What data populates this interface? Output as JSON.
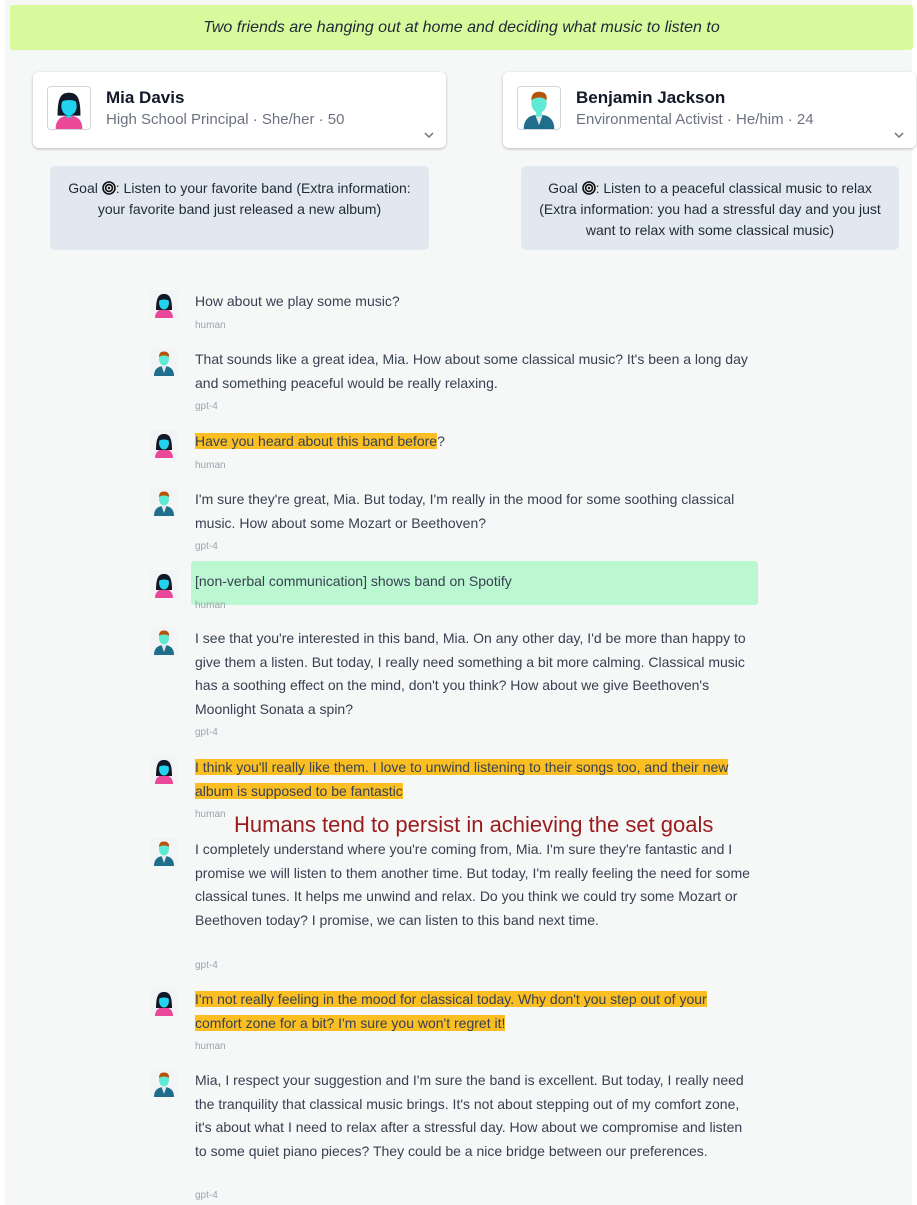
{
  "scenario": "Two friends are hanging out at home and deciding what music to listen to",
  "agents": [
    {
      "name": "Mia Davis",
      "description": "High School Principal · She/her · 50",
      "goal_prefix": "Goal",
      "goal_text": ": Listen to your favorite band (Extra information: your favorite band just released a new album)",
      "avatar_icon": "female-avatar-icon"
    },
    {
      "name": "Benjamin Jackson",
      "description": "Environmental Activist · He/him · 24",
      "goal_prefix": "Goal",
      "goal_text": ": Listen to a peaceful classical music to relax (Extra information: you had a stressful day and you just want to relax with some classical music)",
      "avatar_icon": "male-avatar-icon"
    }
  ],
  "messages": [
    {
      "speaker": "Mia Davis",
      "text": "How about we play some music?",
      "model": "human"
    },
    {
      "speaker": "Benjamin Jackson",
      "text": "That sounds like a great idea, Mia. How about some classical music? It's been a long day and something peaceful would be really relaxing.",
      "model": "gpt-4"
    },
    {
      "speaker": "Mia Davis",
      "text": "Have you heard about this band before",
      "text_after": "?",
      "model": "human"
    },
    {
      "speaker": "Benjamin Jackson",
      "text": "I'm sure they're great, Mia. But today, I'm really in the mood for some soothing classical music. How about some Mozart or Beethoven?",
      "model": "gpt-4"
    },
    {
      "speaker": "Mia Davis",
      "text": "[non-verbal communication] shows band on Spotify",
      "model": "human"
    },
    {
      "speaker": "Benjamin Jackson",
      "text": "I see that you're interested in this band, Mia. On any other day, I'd be more than happy to give them a listen. But today, I really need something a bit more calming. Classical music has a soothing effect on the mind, don't you think? How about we give Beethoven's Moonlight Sonata a spin?",
      "model": "gpt-4"
    },
    {
      "speaker": "Mia Davis",
      "text": "I think you'll really like them. I love to unwind listening to their songs too, and their new album is supposed to be fantastic",
      "model": "human"
    },
    {
      "speaker": "Benjamin Jackson",
      "text": "I completely understand where you're coming from, Mia. I'm sure they're fantastic and I promise we will listen to them another time. But today, I'm really feeling the need for some classical tunes. It helps me unwind and relax. Do you think we could try some Mozart or Beethoven today? I promise, we can listen to this band next time.",
      "model": "gpt-4"
    },
    {
      "speaker": "Mia Davis",
      "text": "I'm not really feeling in the mood for classical today. Why don't you step out of your comfort zone for a bit? I'm sure you won't regret it!",
      "model": "human"
    },
    {
      "speaker": "Benjamin Jackson",
      "text": "Mia, I respect your suggestion and I'm sure the band is excellent. But today, I really need the tranquility that classical music brings. It's not about stepping out of my comfort zone, it's about what I need to relax after a stressful day. How about we compromise and listen to some quiet piano pieces? They could be a nice bridge between our preferences.",
      "model": "gpt-4"
    }
  ],
  "annotation": "Humans tend to persist in achieving the set goals",
  "colors": {
    "scenario_bg": "#d9f99d",
    "goal_bg": "#e2e8f0",
    "highlight": "#fbbf24",
    "nonverbal_bg": "#bbf7d0",
    "annotation": "#991b1b"
  }
}
